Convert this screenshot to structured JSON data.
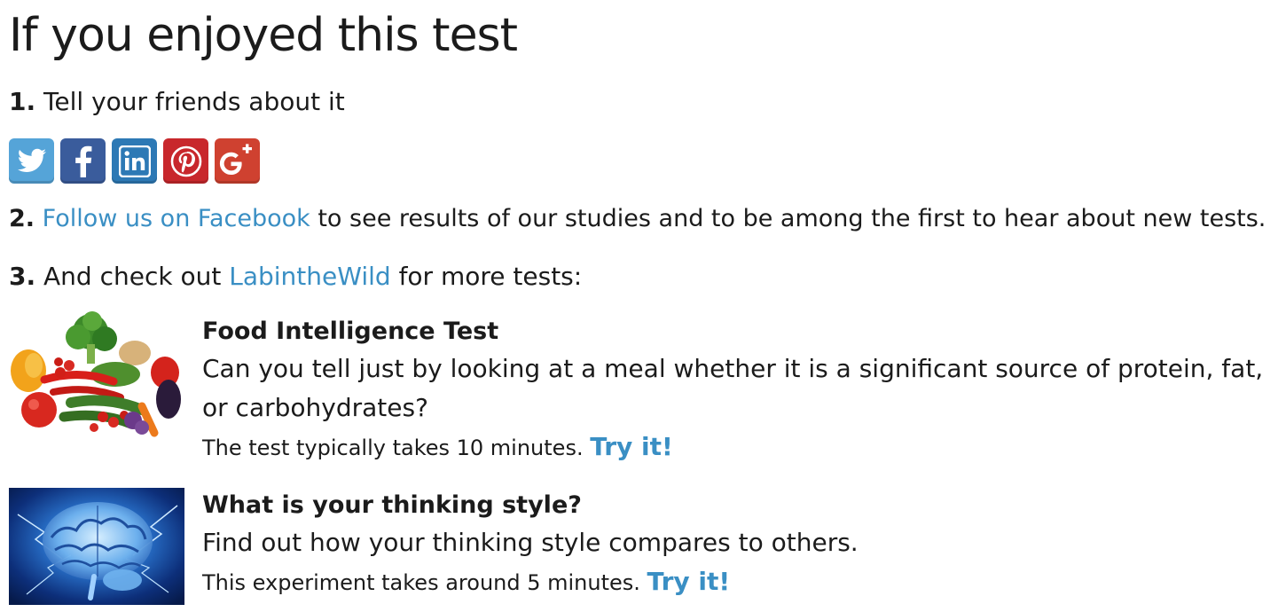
{
  "title": "If you enjoyed this test",
  "step1": {
    "num": "1.",
    "text": "Tell your friends about it"
  },
  "share": [
    {
      "name": "twitter",
      "icon": "twitter-icon",
      "color": "#55a4d8"
    },
    {
      "name": "facebook",
      "icon": "facebook-icon",
      "color": "#3a5c9c"
    },
    {
      "name": "linkedin",
      "icon": "linkedin-icon",
      "color": "#2d79b5"
    },
    {
      "name": "pinterest",
      "icon": "pinterest-icon",
      "color": "#c8272c"
    },
    {
      "name": "google-plus",
      "icon": "google-plus-icon",
      "color": "#cf4130"
    }
  ],
  "step2": {
    "num": "2.",
    "link": "Follow us on Facebook",
    "rest": " to see results of our studies and to be among the first to hear about new tests."
  },
  "step3": {
    "num": "3.",
    "before": "And check out ",
    "link": "LabintheWild",
    "after": " for more tests:"
  },
  "tests": [
    {
      "title": "Food Intelligence Test",
      "description": "Can you tell just by looking at a meal whether it is a significant source of protein, fat, or carbohydrates?",
      "note": "The test typically takes 10 minutes.",
      "cta": "Try it!"
    },
    {
      "title": "What is your thinking style?",
      "description": "Find out how your thinking style compares to others.",
      "note": "This experiment takes around 5 minutes.",
      "cta": "Try it!"
    }
  ],
  "colors": {
    "link": "#3a8fc4",
    "text": "#1b1b1b"
  }
}
